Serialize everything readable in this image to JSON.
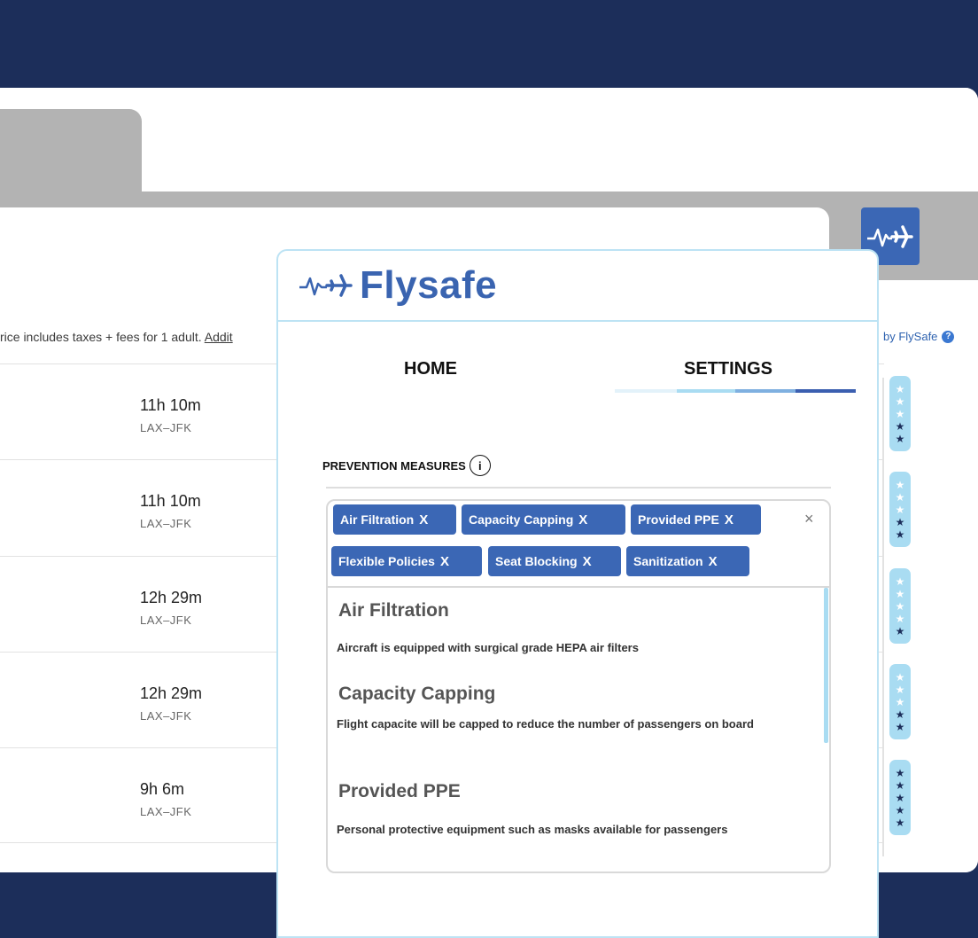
{
  "browser": {
    "price_note_prefix": "rice includes taxes + fees for 1 adult.",
    "price_note_link": "Addit",
    "powered_by": "by FlySafe",
    "help_icon": "?"
  },
  "results": [
    {
      "duration": "11h 10m",
      "route": "LAX–JFK",
      "stars": 2
    },
    {
      "duration": "11h 10m",
      "route": "LAX–JFK",
      "stars": 2
    },
    {
      "duration": "12h 29m",
      "route": "LAX–JFK",
      "stars": 1
    },
    {
      "duration": "12h 29m",
      "route": "LAX–JFK",
      "stars": 2
    },
    {
      "duration": "9h 6m",
      "route": "LAX–JFK",
      "stars": 5
    }
  ],
  "popup": {
    "brand": "Flysafe",
    "tabs": {
      "home": "HOME",
      "settings": "SETTINGS"
    },
    "measures_label": "PREVENTION MEASURES",
    "info_icon_label": "i",
    "chips": [
      "Air Filtration",
      "Capacity Capping",
      "Provided PPE",
      "Flexible Policies",
      "Seat Blocking",
      "Sanitization"
    ],
    "chip_remove": "X",
    "clear_all": "×",
    "options": [
      {
        "title": "Air Filtration",
        "desc": "Aircraft is equipped with surgical grade HEPA air filters"
      },
      {
        "title": "Capacity Capping",
        "desc": "Flight capacite will be capped to reduce the number of passengers on board"
      },
      {
        "title": "Provided PPE",
        "desc": "Personal protective equipment such as masks available for passengers"
      }
    ]
  },
  "colors": {
    "background": "#1c2e5a",
    "brand_blue": "#3b67b5",
    "light_blue": "#a9dcf2",
    "border_blue": "#bde3f4"
  }
}
